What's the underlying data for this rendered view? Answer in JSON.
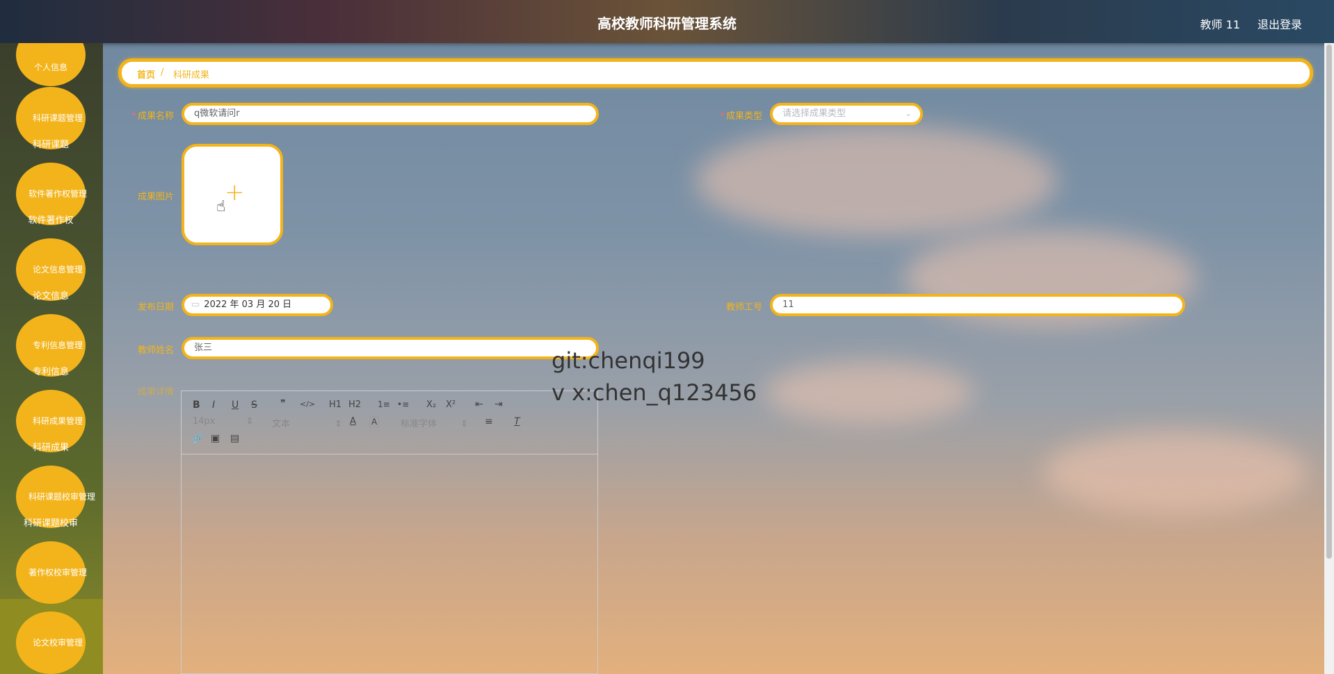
{
  "header": {
    "title": "高校教师科研管理系统",
    "user": "教师 11",
    "logout": "退出登录"
  },
  "sidebar": {
    "items": [
      {
        "main": "个人信息",
        "sub": ""
      },
      {
        "main": "科研课题管理",
        "sub": "科研课题"
      },
      {
        "main": "软件著作权管理",
        "sub": "软件著作权"
      },
      {
        "main": "论文信息管理",
        "sub": "论文信息"
      },
      {
        "main": "专利信息管理",
        "sub": "专利信息"
      },
      {
        "main": "科研成果管理",
        "sub": "科研成果"
      },
      {
        "main": "科研课题校审管理",
        "sub": "科研课题校审"
      },
      {
        "main": "著作权校审管理",
        "sub": ""
      },
      {
        "main": "论文校审管理",
        "sub": ""
      }
    ]
  },
  "breadcrumb": {
    "home": "首页",
    "separator": "/",
    "current": "科研成果"
  },
  "form": {
    "name_label": "成果名称",
    "name_value": "q微软请问r",
    "type_label": "成果类型",
    "type_placeholder": "请选择成果类型",
    "image_label": "成果图片",
    "upload_plus": "+",
    "date_label": "发布日期",
    "date_value": "2022 年 03 月 20 日",
    "teacher_no_label": "教师工号",
    "teacher_no_value": "11",
    "teacher_name_label": "教师姓名",
    "teacher_name_value": "张三",
    "detail_label": "成果详情",
    "required_mark": "*"
  },
  "editor": {
    "font_size": "14px",
    "block_type": "文本",
    "font_family": "标准字体",
    "buttons": [
      "B",
      "I",
      "U",
      "S",
      "❞",
      "</>",
      "H1",
      "H2",
      "1≡",
      "•≡",
      "X₂",
      "X²",
      "⇤",
      "⇥"
    ]
  },
  "watermark": {
    "line1": "git:chenqi199",
    "line2": "v x:chen_q123456"
  },
  "icons": {
    "calendar": "calendar-icon",
    "dropdown": "chevron-down-icon",
    "cursor": "hand-pointer-icon"
  },
  "colors": {
    "accent": "#f3b41b",
    "required": "#f56c6c"
  }
}
